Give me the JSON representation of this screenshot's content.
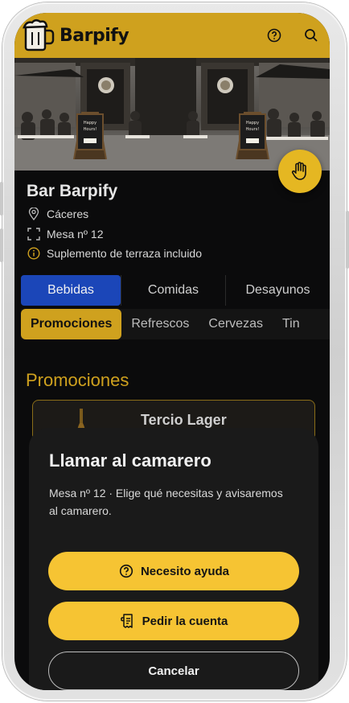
{
  "app": {
    "brand": "Barpify",
    "accent": "#cfa11e",
    "tab_active": "#1b46b8",
    "button_yellow": "#f6c433"
  },
  "header": {
    "icons": [
      "help-circle-icon",
      "search-icon"
    ]
  },
  "venue": {
    "name": "Bar Barpify",
    "city": "Cáceres",
    "table": "Mesa nº 12",
    "notice": "Suplemento de terraza incluido"
  },
  "hero": {
    "sign_text": "Happy Hours!",
    "sign_brand": "Barpify"
  },
  "categories": [
    {
      "label": "Bebidas",
      "active": true
    },
    {
      "label": "Comidas",
      "active": false
    },
    {
      "label": "Desayunos",
      "active": false
    }
  ],
  "subcategories": [
    {
      "label": "Promociones",
      "active": true
    },
    {
      "label": "Refrescos",
      "active": false
    },
    {
      "label": "Cervezas",
      "active": false
    },
    {
      "label": "Tin",
      "active": false
    }
  ],
  "section": {
    "title": "Promociones"
  },
  "product": {
    "name": "Tercio Lager"
  },
  "sheet": {
    "title": "Llamar al camarero",
    "description": "Mesa nº 12 · Elige qué necesitas y avisaremos al camarero.",
    "buttons": {
      "help": "Necesito ayuda",
      "bill": "Pedir la cuenta",
      "cancel": "Cancelar"
    }
  }
}
